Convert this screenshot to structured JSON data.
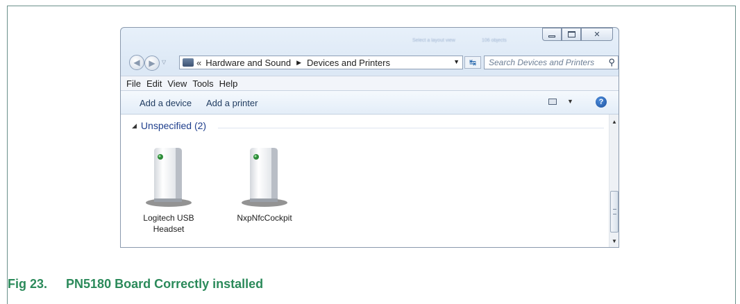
{
  "window": {
    "address_bar": {
      "chevron": "«",
      "crumbs": [
        "Hardware and Sound",
        "Devices and Printers"
      ],
      "separator": "▶"
    },
    "search": {
      "placeholder": "Search Devices and Printers"
    },
    "menu": [
      "File",
      "Edit",
      "View",
      "Tools",
      "Help"
    ],
    "toolbar": {
      "add_device": "Add a device",
      "add_printer": "Add a printer",
      "help": "?"
    },
    "group": {
      "label": "Unspecified (2)"
    },
    "devices": [
      {
        "name": "Logitech USB Headset",
        "icon": "device-tower-icon"
      },
      {
        "name": "NxpNfcCockpit",
        "icon": "device-tower-icon"
      }
    ],
    "background_text": [
      "Select a layout view",
      "106 objects"
    ]
  },
  "figure": {
    "number": "Fig 23.",
    "title": "PN5180 Board Correctly installed",
    "color": "#2b8a5a"
  }
}
